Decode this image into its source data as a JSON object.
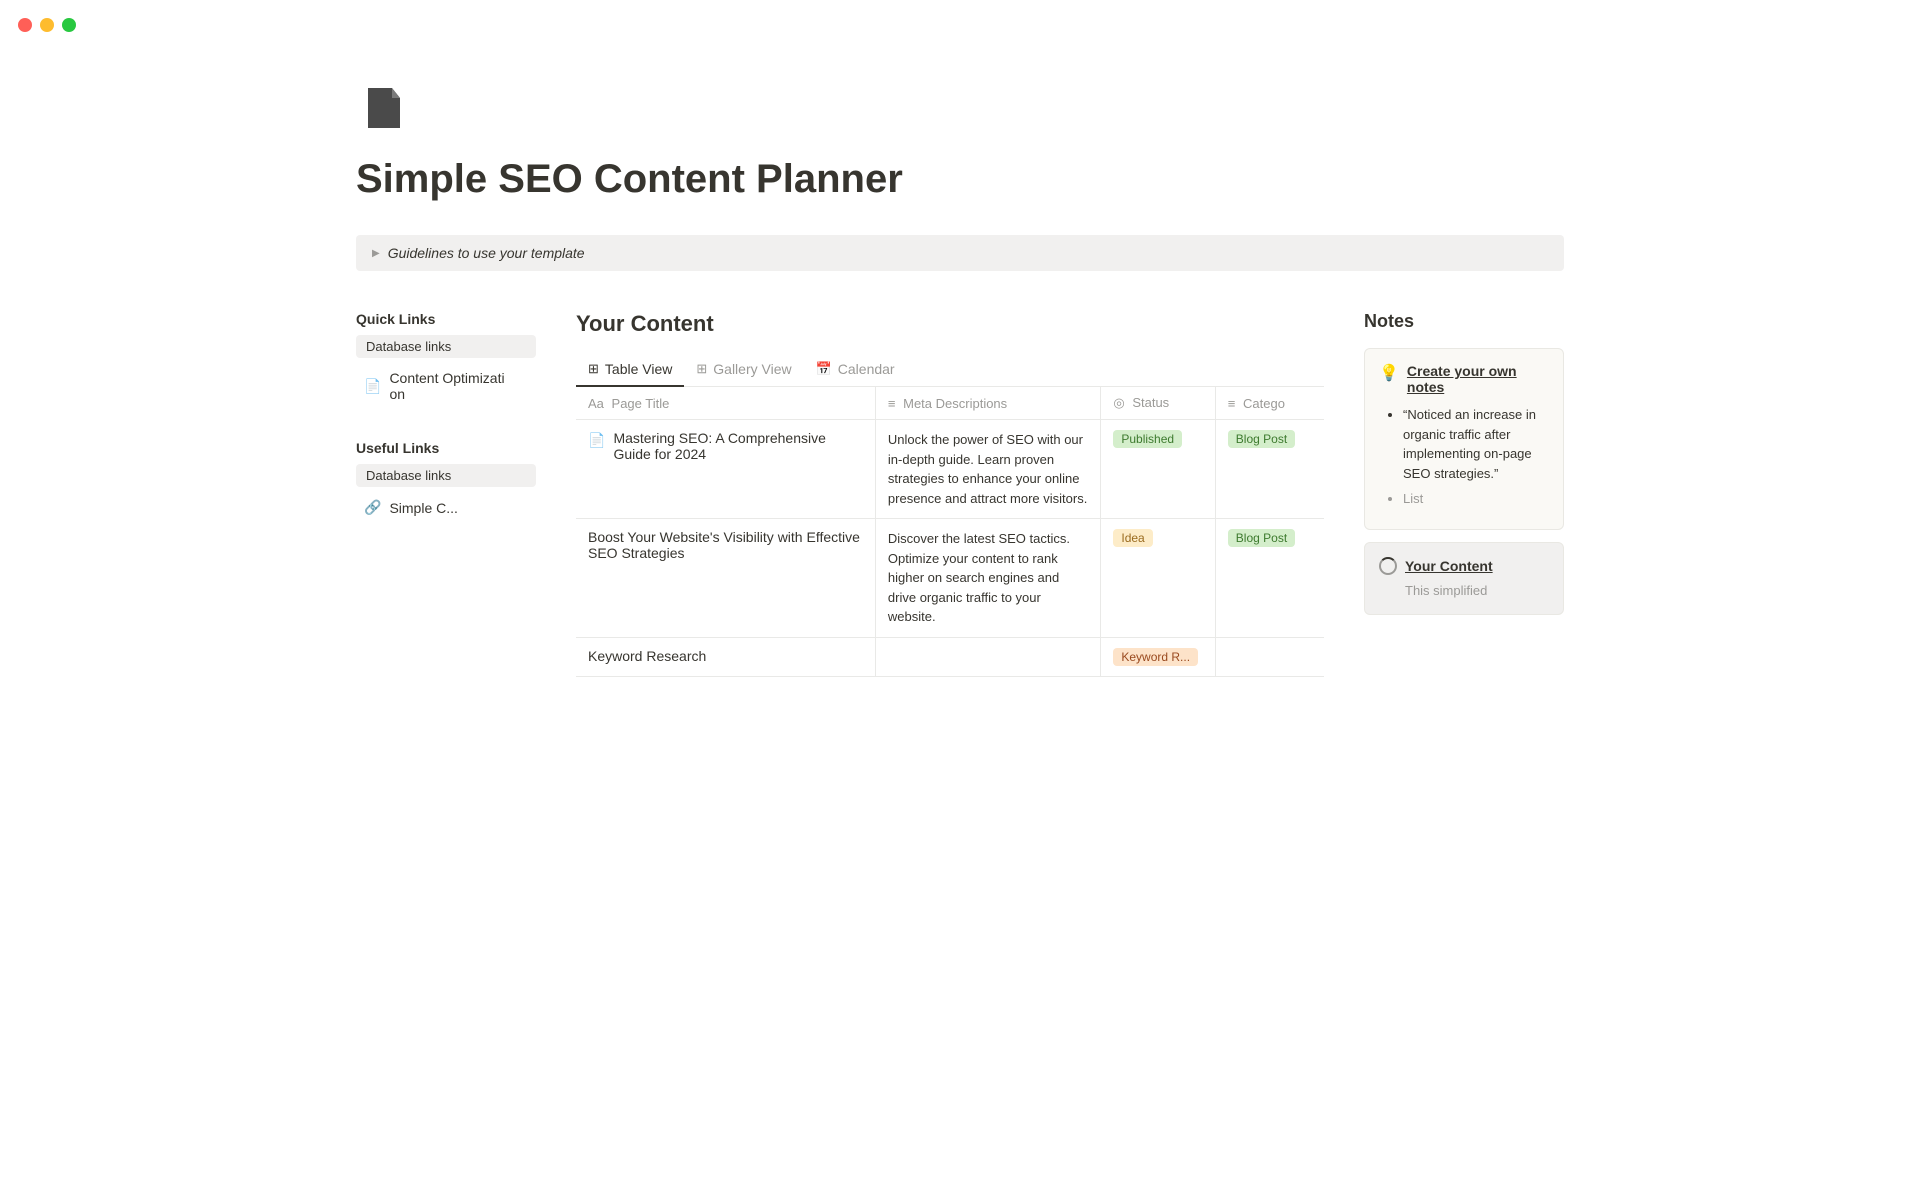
{
  "window": {
    "traffic_lights": [
      "red",
      "yellow",
      "green"
    ]
  },
  "page": {
    "icon_label": "document-icon",
    "title": "Simple SEO Content Planner",
    "guidelines_toggle": "Guidelines to use your template"
  },
  "sidebar": {
    "quick_links_title": "Quick Links",
    "quick_links_badge": "Database links",
    "quick_links_items": [
      {
        "label": "Content Optimization",
        "icon": "📄"
      }
    ],
    "useful_links_title": "Useful Links",
    "useful_links_badge": "Database links",
    "useful_links_items": [
      {
        "label": "Simple C...",
        "icon": "🔗"
      }
    ]
  },
  "content": {
    "title": "Your Content",
    "tabs": [
      {
        "label": "Table View",
        "icon": "⊞",
        "active": true
      },
      {
        "label": "Gallery View",
        "icon": "⊞",
        "active": false
      },
      {
        "label": "Calendar",
        "icon": "📅",
        "active": false
      }
    ],
    "table": {
      "headers": [
        {
          "label": "Page Title",
          "icon": "Aa"
        },
        {
          "label": "Meta Descriptions",
          "icon": "≡"
        },
        {
          "label": "Status",
          "icon": "◎"
        },
        {
          "label": "Catego",
          "icon": "≡"
        }
      ],
      "rows": [
        {
          "title": "Mastering SEO: A Comprehensive Guide for 2024",
          "meta": "Unlock the power of SEO with our in-depth guide. Learn proven strategies to enhance your online presence and attract more visitors.",
          "status": "Published",
          "status_type": "published",
          "category": "Blog Post",
          "category_type": "blog"
        },
        {
          "title": "Boost Your Website's Visibility with Effective SEO Strategies",
          "meta": "Discover the latest SEO tactics. Optimize your content to rank higher on search engines and drive organic traffic to your website.",
          "status": "Idea",
          "status_type": "idea",
          "category": "Blog Post",
          "category_type": "blog"
        },
        {
          "title": "Keyword Research",
          "meta": "",
          "status": "Keyword R...",
          "status_type": "keyword",
          "category": "",
          "category_type": ""
        }
      ]
    }
  },
  "notes": {
    "title": "Notes",
    "cards": [
      {
        "type": "tip",
        "title": "Create your own notes",
        "bullet_items": [
          "“Noticed an increase in organic traffic after implementing on-page SEO strategies.”",
          "List"
        ]
      },
      {
        "type": "db",
        "title": "Your Content",
        "body": "This simplified"
      }
    ]
  }
}
